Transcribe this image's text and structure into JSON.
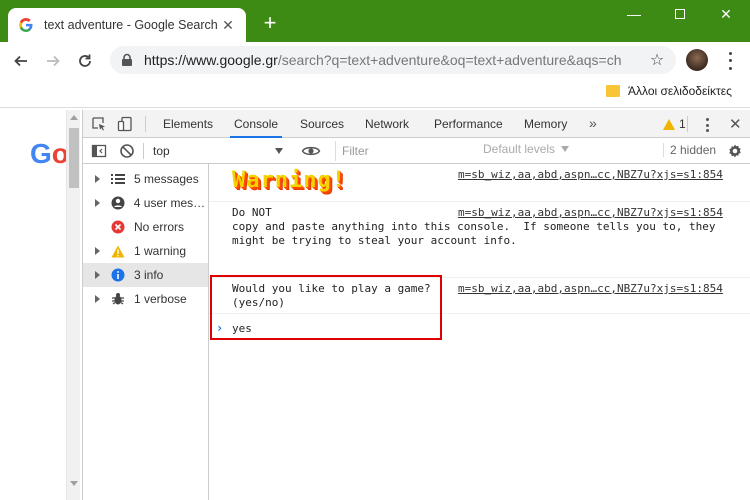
{
  "browser": {
    "tab_title": "text adventure - Google Search",
    "new_tab": "+",
    "url_main": "https://www.google.gr",
    "url_rest": "/search?q=text+adventure&oq=text+adventure&aqs=ch",
    "bookmark_folder": "Άλλοι σελιδοδείκτες"
  },
  "devtools": {
    "tabs": [
      "Elements",
      "Console",
      "Sources",
      "Network",
      "Performance",
      "Memory"
    ],
    "more": "»",
    "warning_count": "1",
    "context": "top",
    "filter_placeholder": "Filter",
    "levels": "Default levels",
    "hidden": "2 hidden",
    "sidebar": [
      {
        "label": "5 messages",
        "icon": "list-icon"
      },
      {
        "label": "4 user mess...",
        "icon": "user-icon"
      },
      {
        "label": "No errors",
        "icon": "error-icon"
      },
      {
        "label": "1 warning",
        "icon": "warning-icon"
      },
      {
        "label": "3 info",
        "icon": "info-icon",
        "selected": true
      },
      {
        "label": "1 verbose",
        "icon": "bug-icon"
      }
    ],
    "messages": [
      {
        "text": "Warning!",
        "source": "m=sb_wiz,aa,abd,aspn…cc,NBZ7u?xjs=s1:854"
      },
      {
        "text": "Do NOT\ncopy and paste anything into this console.  If someone tells you to, they\nmight be trying to steal your account info.",
        "source": "m=sb_wiz,aa,abd,aspn…cc,NBZ7u?xjs=s1:854"
      },
      {
        "text": "Would you like to play a game?\n(yes/no)",
        "source": "m=sb_wiz,aa,abd,aspn…cc,NBZ7u?xjs=s1:854"
      }
    ],
    "prompt_input": "yes"
  },
  "colors": {
    "titlebar": "#3d8a14",
    "highlight": "#e00000",
    "accent": "#1a73e8"
  }
}
